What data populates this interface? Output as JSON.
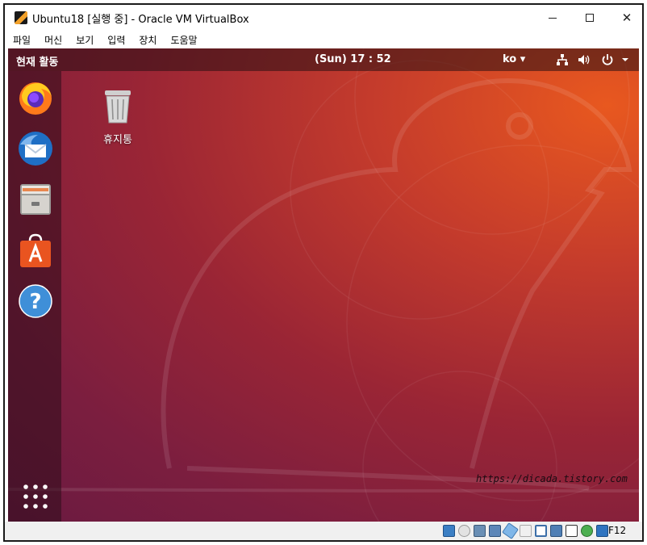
{
  "window": {
    "title": "Ubuntu18 [실행 중] - Oracle VM VirtualBox",
    "controls": {
      "minimize": "minimize",
      "maximize": "maximize",
      "close": "✕"
    }
  },
  "menubar": {
    "items": [
      {
        "label": "파일"
      },
      {
        "label": "머신"
      },
      {
        "label": "보기"
      },
      {
        "label": "입력"
      },
      {
        "label": "장치"
      },
      {
        "label": "도움말"
      }
    ]
  },
  "guest": {
    "topbar": {
      "activities": "현재 활동",
      "clock": "(Sun) 17 : 52",
      "input_language": "ko ▾",
      "tray_icons": [
        "network-icon",
        "volume-icon",
        "power-icon",
        "menu-arrow-icon"
      ]
    },
    "dock": {
      "items": [
        {
          "icon": "firefox-icon"
        },
        {
          "icon": "thunderbird-icon"
        },
        {
          "icon": "files-icon"
        },
        {
          "icon": "software-center-icon"
        },
        {
          "icon": "help-icon"
        }
      ],
      "show_apps_icon": "grid-icon"
    },
    "desktop": {
      "trash_label": "휴지통"
    },
    "watermark": "https://dicada.tistory.com"
  },
  "statusbar": {
    "icons": [
      "hdd-icon",
      "optical-icon",
      "audio-icon",
      "network-icon",
      "usb-icon",
      "shared-folder-icon",
      "display-icon",
      "recording-icon",
      "virtualization-icon",
      "mouse-integration-icon",
      "keyboard-icon"
    ],
    "host_key": "F12"
  },
  "colors": {
    "ubuntu_orange": "#e8581f",
    "ubuntu_aubergine": "#6a1a40",
    "topbar": "#2a0e12",
    "statusbar": "#f0f0f0"
  }
}
